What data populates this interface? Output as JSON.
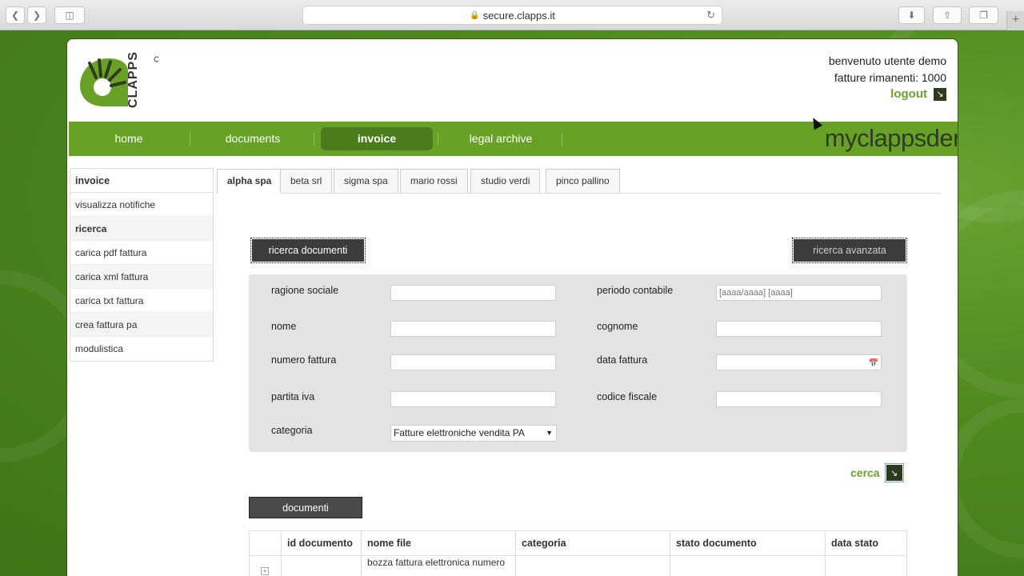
{
  "browser": {
    "url": "secure.clapps.it",
    "new_tab": "+"
  },
  "header": {
    "logo_text": "CLAPPS",
    "welcome": "benvenuto  utente demo",
    "remaining": "fatture rimanenti: 1000",
    "logout": "logout"
  },
  "nav": {
    "items": [
      "home",
      "documents",
      "invoice",
      "legal archive"
    ],
    "active": "invoice",
    "brand": "myclappsder"
  },
  "sidebar": {
    "header": "invoice",
    "items": [
      "visualizza notifiche",
      "ricerca",
      "carica pdf fattura",
      "carica xml fattura",
      "carica txt fattura",
      "crea fattura pa",
      "modulistica"
    ]
  },
  "tabs": [
    "alpha spa",
    "beta srl",
    "sigma spa",
    "mario rossi",
    "studio verdi",
    "pinco pallino"
  ],
  "search": {
    "btn_documents": "ricerca documenti",
    "btn_advanced": "ricerca avanzata",
    "labels": {
      "ragione_sociale": "ragione sociale",
      "periodo_contabile": "periodo contabile",
      "nome": "nome",
      "cognome": "cognome",
      "numero_fattura": "numero fattura",
      "data_fattura": "data fattura",
      "partita_iva": "partita iva",
      "codice_fiscale": "codice fiscale",
      "categoria": "categoria"
    },
    "periodo_placeholder": "[aaaa/aaaa] [aaaa]",
    "categoria_value": "Fatture elettroniche vendita PA",
    "cerca": "cerca"
  },
  "documents": {
    "button": "documenti",
    "columns": [
      "id documento",
      "nome file",
      "categoria",
      "stato documento",
      "data stato"
    ],
    "rows": [
      {
        "id": "",
        "file": "bozza fattura elettronica numero",
        "categoria": "",
        "stato": "",
        "data": ""
      }
    ]
  },
  "colors": {
    "accent": "#67a125",
    "accent_dark": "#4b7c1b",
    "link_green": "#6aa131"
  }
}
